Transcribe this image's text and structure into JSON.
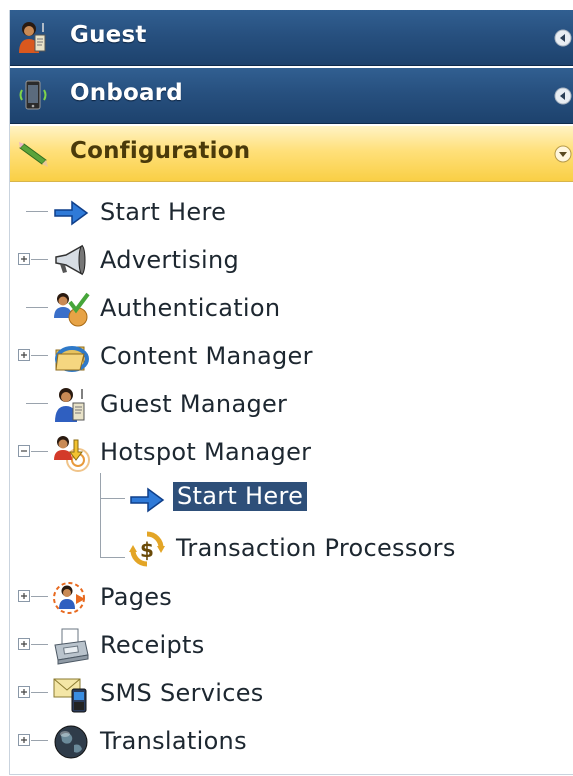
{
  "headers": [
    {
      "label": "Guest",
      "icon": "guest-user-icon",
      "state": "collapsed"
    },
    {
      "label": "Onboard",
      "icon": "mobile-device-icon",
      "state": "collapsed"
    },
    {
      "label": "Configuration",
      "icon": "pencil-icon",
      "state": "expanded"
    }
  ],
  "tree": {
    "start_here": "Start Here",
    "advertising": "Advertising",
    "authentication": "Authentication",
    "content_manager": "Content Manager",
    "guest_manager": "Guest Manager",
    "hotspot_manager": "Hotspot Manager",
    "hotspot_start_here": "Start Here",
    "transaction_processors": "Transaction Processors",
    "pages": "Pages",
    "receipts": "Receipts",
    "sms_services": "SMS Services",
    "translations": "Translations"
  },
  "colors": {
    "header_blue": "#27507f",
    "header_yellow": "#ffe07a",
    "selection": "#2e4f79"
  }
}
